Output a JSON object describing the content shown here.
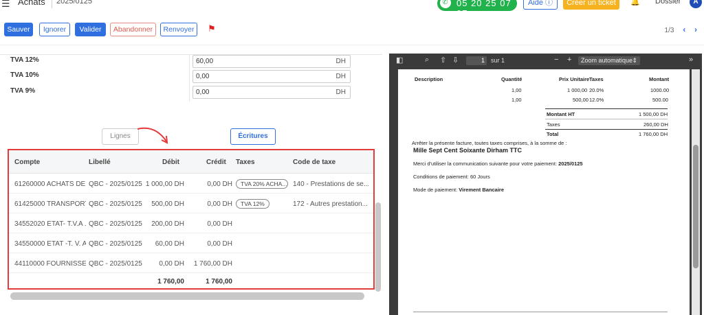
{
  "header": {
    "app_title": "Achats",
    "doc_ref": "2025/0125",
    "phone": "05 20 25 07 07",
    "aide": "Aide ⓘ",
    "ticket": "Créer un ticket",
    "dossier": "Dossier",
    "avatar": "A"
  },
  "toolbar": {
    "save": "Sauver",
    "ignore": "Ignorer",
    "validate": "Valider",
    "abandon": "Abandonner",
    "resend": "Renvoyer",
    "pager": "1/3"
  },
  "tva": [
    {
      "label": "TVA 12%",
      "value": "60,00",
      "unit": "DH"
    },
    {
      "label": "TVA 10%",
      "value": "0,00",
      "unit": "DH"
    },
    {
      "label": "TVA 9%",
      "value": "0,00",
      "unit": "DH"
    }
  ],
  "tabs": {
    "lignes": "Lignes",
    "ecritures": "Écritures"
  },
  "entries": {
    "columns": [
      "Compte",
      "Libellé",
      "Débit",
      "Crédit",
      "Taxes",
      "Code de taxe"
    ],
    "rows": [
      {
        "compte": "61260000 ACHATS DE T...",
        "libelle": "QBC - 2025/0125",
        "debit": "1 000,00 DH",
        "credit": "0,00 DH",
        "taxe": "TVA 20% ACHA...",
        "code": "140 - Prestations de se..."
      },
      {
        "compte": "61425000 TRANSPORTS...",
        "libelle": "QBC - 2025/0125",
        "debit": "500,00 DH",
        "credit": "0,00 DH",
        "taxe": "TVA 12%",
        "code": "172 - Autres prestation..."
      },
      {
        "compte": "34552020 ETAT- T.V.A ...",
        "libelle": "QBC - 2025/0125",
        "debit": "200,00 DH",
        "credit": "0,00 DH",
        "taxe": "",
        "code": ""
      },
      {
        "compte": "34550000 ETAT -T. V. A...",
        "libelle": "QBC - 2025/0125",
        "debit": "60,00 DH",
        "credit": "0,00 DH",
        "taxe": "",
        "code": ""
      },
      {
        "compte": "44110000 FOURNISSEUR...",
        "libelle": "QBC - 2025/0125",
        "debit": "0,00 DH",
        "credit": "1 760,00 DH",
        "taxe": "",
        "code": ""
      }
    ],
    "total_debit": "1 760,00",
    "total_credit": "1 760,00"
  },
  "pdf": {
    "page": "1",
    "of": "sur 1",
    "zoom": "Zoom automatique",
    "columns": [
      "Description",
      "Quantité",
      "Prix Unitaire",
      "Taxes",
      "Montant"
    ],
    "lines": [
      {
        "qty": "1,00",
        "price": "1 000,00",
        "tax": "20.0%",
        "amount": "1000.00"
      },
      {
        "qty": "1,00",
        "price": "500,00",
        "tax": "12.0%",
        "amount": "500.00"
      }
    ],
    "totals": [
      {
        "label": "Montant HT",
        "value": "1 500,00 DH"
      },
      {
        "label": "Taxes",
        "value": "260,00 DH"
      },
      {
        "label": "Total",
        "value": "1 760,00 DH"
      }
    ],
    "arreter": "Arrêter la présente facture, toutes taxes comprises, à la somme de :",
    "amount_words": "Mille Sept Cent Soixante Dirham TTC",
    "merci_prefix": "Merci d'utiliser la communication suivante pour votre paiement: ",
    "merci_ref": "2025/0125",
    "conditions": "Conditions de paiement: 60 Jours",
    "mode_prefix": "Mode de paiement: ",
    "mode_value": "Virement Bancaire"
  },
  "colors": {
    "primary": "#2f6fe0",
    "green": "#22b24c",
    "orange": "#f7b21f",
    "highlight": "#e33a3a"
  }
}
